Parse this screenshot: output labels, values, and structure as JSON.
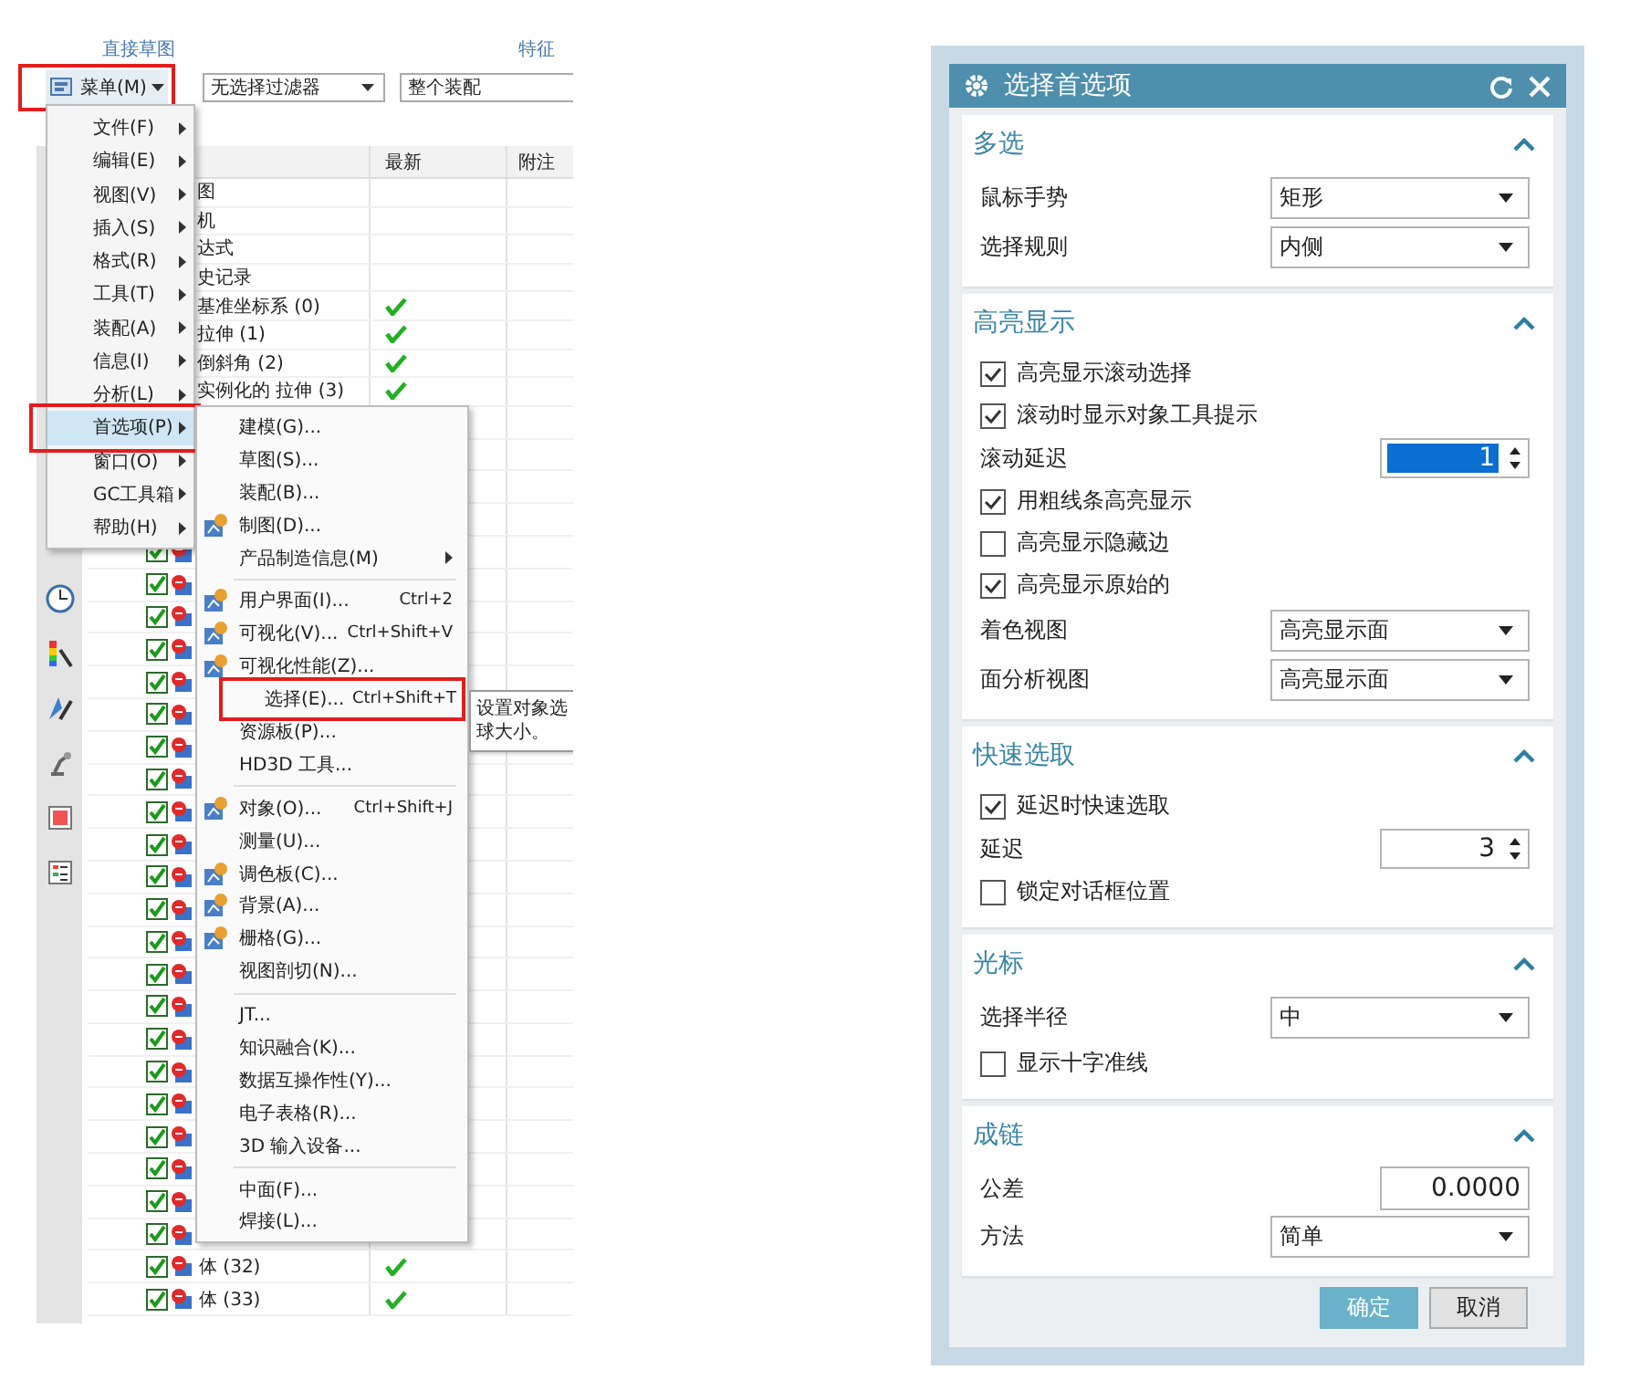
{
  "toolbar": {
    "ribbon_group_labels": [
      "直接草图",
      "特征"
    ],
    "menu_button": {
      "label": "菜单(M)",
      "callout": true
    },
    "selection_filter": "无选择过滤器",
    "scope": "整个装配"
  },
  "navigator": {
    "columns": [
      "最新",
      "附注"
    ],
    "rows": [
      {
        "kind": "node",
        "name": "图"
      },
      {
        "kind": "node",
        "name": "机"
      },
      {
        "kind": "node",
        "name": "达式"
      },
      {
        "kind": "node",
        "name": "史记录"
      },
      {
        "kind": "node",
        "name": "基准坐标系 (0)",
        "latest": true
      },
      {
        "kind": "node",
        "name": "拉伸 (1)",
        "latest": true
      },
      {
        "kind": "node",
        "name": "倒斜角 (2)",
        "latest": true
      },
      {
        "kind": "node",
        "name": "实例化的 拉伸 (3)",
        "latest": true
      },
      {
        "kind": "covered"
      },
      {
        "kind": "covered"
      },
      {
        "kind": "covered"
      },
      {
        "kind": "covered"
      },
      {
        "kind": "feature",
        "checked": true
      },
      {
        "kind": "feature",
        "checked": true
      },
      {
        "kind": "feature",
        "checked": true
      },
      {
        "kind": "feature",
        "checked": true
      },
      {
        "kind": "feature",
        "checked": true
      },
      {
        "kind": "feature",
        "checked": true
      },
      {
        "kind": "feature",
        "checked": true
      },
      {
        "kind": "feature",
        "checked": true
      },
      {
        "kind": "feature",
        "checked": true
      },
      {
        "kind": "feature",
        "checked": true
      },
      {
        "kind": "feature",
        "checked": true
      },
      {
        "kind": "feature",
        "checked": true
      },
      {
        "kind": "feature",
        "checked": true
      },
      {
        "kind": "feature",
        "checked": true
      },
      {
        "kind": "feature",
        "checked": true
      },
      {
        "kind": "feature",
        "checked": true
      },
      {
        "kind": "feature",
        "checked": true
      },
      {
        "kind": "feature",
        "checked": true
      },
      {
        "kind": "feature",
        "checked": true
      },
      {
        "kind": "feature",
        "checked": true
      },
      {
        "kind": "feature",
        "checked": true
      },
      {
        "kind": "feature",
        "checked": true
      },
      {
        "kind": "feature",
        "checked": true,
        "name": "体 (32)",
        "latest": true
      },
      {
        "kind": "feature",
        "checked": true,
        "name": "体 (33)",
        "latest": true
      }
    ]
  },
  "main_menu": {
    "items": [
      {
        "label": "文件(F)",
        "selected": false,
        "callout": false
      },
      {
        "label": "编辑(E)",
        "selected": false,
        "callout": false
      },
      {
        "label": "视图(V)",
        "selected": false,
        "callout": false
      },
      {
        "label": "插入(S)",
        "selected": false,
        "callout": false
      },
      {
        "label": "格式(R)",
        "selected": false,
        "callout": false
      },
      {
        "label": "工具(T)",
        "selected": false,
        "callout": false
      },
      {
        "label": "装配(A)",
        "selected": false,
        "callout": false
      },
      {
        "label": "信息(I)",
        "selected": false,
        "callout": false
      },
      {
        "label": "分析(L)",
        "selected": false,
        "callout": false
      },
      {
        "label": "首选项(P)",
        "selected": true,
        "callout": true
      },
      {
        "label": "窗口(O)",
        "selected": false,
        "callout": false
      },
      {
        "label": "GC工具箱",
        "selected": false,
        "callout": false
      },
      {
        "label": "帮助(H)",
        "selected": false,
        "callout": false
      }
    ]
  },
  "submenu": {
    "items": [
      {
        "kind": "item",
        "label": "建模(G)...",
        "icon": false
      },
      {
        "kind": "item",
        "label": "草图(S)...",
        "icon": false
      },
      {
        "kind": "item",
        "label": "装配(B)...",
        "icon": false
      },
      {
        "kind": "item",
        "label": "制图(D)...",
        "icon": true
      },
      {
        "kind": "item",
        "label": "产品制造信息(M)",
        "icon": false,
        "submenu": true
      },
      {
        "kind": "separator"
      },
      {
        "kind": "item",
        "label": "用户界面(I)...",
        "icon": true,
        "shortcut": "Ctrl+2"
      },
      {
        "kind": "item",
        "label": "可视化(V)...",
        "icon": true,
        "shortcut": "Ctrl+Shift+V"
      },
      {
        "kind": "item",
        "label": "可视化性能(Z)...",
        "icon": true
      },
      {
        "kind": "item",
        "label": "选择(E)...",
        "icon": false,
        "shortcut": "Ctrl+Shift+T",
        "callout": true
      },
      {
        "kind": "item",
        "label": "资源板(P)...",
        "icon": false
      },
      {
        "kind": "item",
        "label": "HD3D 工具...",
        "icon": false
      },
      {
        "kind": "separator"
      },
      {
        "kind": "item",
        "label": "对象(O)...",
        "icon": true,
        "shortcut": "Ctrl+Shift+J"
      },
      {
        "kind": "item",
        "label": "测量(U)...",
        "icon": false
      },
      {
        "kind": "item",
        "label": "调色板(C)...",
        "icon": true
      },
      {
        "kind": "item",
        "label": "背景(A)...",
        "icon": true
      },
      {
        "kind": "item",
        "label": "栅格(G)...",
        "icon": true
      },
      {
        "kind": "item",
        "label": "视图剖切(N)...",
        "icon": false
      },
      {
        "kind": "separator"
      },
      {
        "kind": "item",
        "label": "JT...",
        "icon": false
      },
      {
        "kind": "item",
        "label": "知识融合(K)...",
        "icon": false
      },
      {
        "kind": "item",
        "label": "数据互操作性(Y)...",
        "icon": false
      },
      {
        "kind": "item",
        "label": "电子表格(R)...",
        "icon": false
      },
      {
        "kind": "item",
        "label": "3D 输入设备...",
        "icon": false
      },
      {
        "kind": "separator"
      },
      {
        "kind": "item",
        "label": "中面(F)...",
        "icon": false
      },
      {
        "kind": "item",
        "label": "焊接(L)...",
        "icon": false
      }
    ]
  },
  "tooltip": {
    "lines": [
      "设置对象选",
      "球大小。"
    ]
  },
  "dialog": {
    "title": "选择首选项",
    "sections": [
      {
        "title": "多选",
        "expanded": true,
        "rows": [
          {
            "kind": "dropdown",
            "label": "鼠标手势",
            "value": "矩形"
          },
          {
            "kind": "dropdown",
            "label": "选择规则",
            "value": "内侧"
          }
        ]
      },
      {
        "title": "高亮显示",
        "expanded": true,
        "rows": [
          {
            "kind": "checkbox",
            "label": "高亮显示滚动选择",
            "checked": true
          },
          {
            "kind": "checkbox",
            "label": "滚动时显示对象工具提示",
            "checked": true
          },
          {
            "kind": "spinner",
            "label": "滚动延迟",
            "value": "1",
            "selected": true
          },
          {
            "kind": "checkbox",
            "label": "用粗线条高亮显示",
            "checked": true
          },
          {
            "kind": "checkbox",
            "label": "高亮显示隐藏边",
            "checked": false
          },
          {
            "kind": "checkbox",
            "label": "高亮显示原始的",
            "checked": true
          },
          {
            "kind": "dropdown",
            "label": "着色视图",
            "value": "高亮显示面"
          },
          {
            "kind": "dropdown",
            "label": "面分析视图",
            "value": "高亮显示面"
          }
        ]
      },
      {
        "title": "快速选取",
        "expanded": true,
        "rows": [
          {
            "kind": "checkbox",
            "label": "延迟时快速选取",
            "checked": true
          },
          {
            "kind": "spinner",
            "label": "延迟",
            "value": "3",
            "selected": false
          },
          {
            "kind": "checkbox",
            "label": "锁定对话框位置",
            "checked": false
          }
        ]
      },
      {
        "title": "光标",
        "expanded": true,
        "rows": [
          {
            "kind": "dropdown",
            "label": "选择半径",
            "value": "中"
          },
          {
            "kind": "checkbox",
            "label": "显示十字准线",
            "checked": false
          }
        ]
      },
      {
        "title": "成链",
        "expanded": true,
        "rows": [
          {
            "kind": "number",
            "label": "公差",
            "value": "0.0000"
          },
          {
            "kind": "dropdown",
            "label": "方法",
            "value": "简单"
          }
        ]
      }
    ],
    "buttons": [
      {
        "label": "确定",
        "kind": "primary"
      },
      {
        "label": "取消",
        "kind": "secondary"
      }
    ]
  }
}
